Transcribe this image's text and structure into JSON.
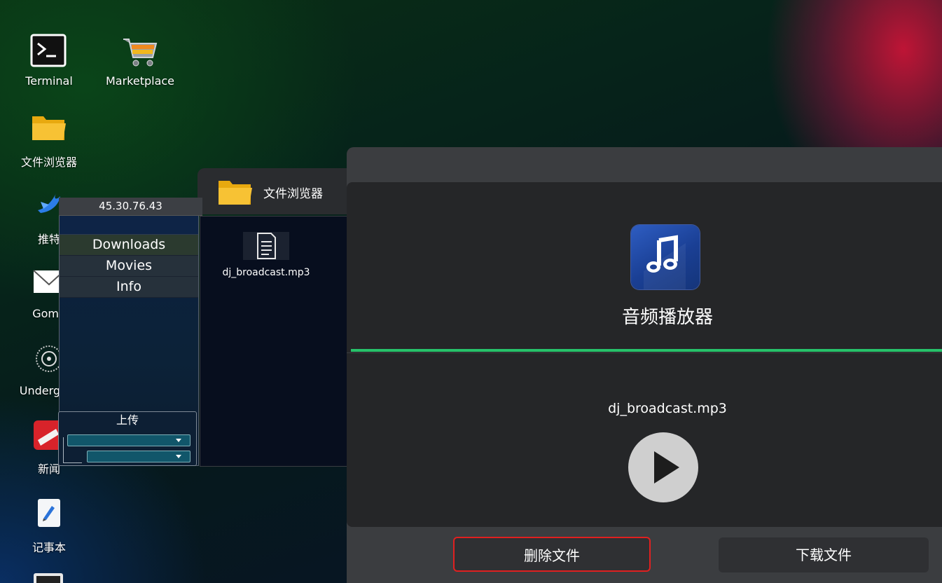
{
  "desktop": {
    "icons": [
      {
        "label": "Terminal",
        "icon": "terminal-icon"
      },
      {
        "label": "Marketplace",
        "icon": "shopping-cart-icon"
      },
      {
        "label": "文件浏览器",
        "icon": "folder-icon"
      },
      {
        "label": "推特",
        "icon": "bird-icon"
      },
      {
        "label": "Goma",
        "icon": "mail-icon"
      },
      {
        "label": "Undergrou",
        "icon": "underground-icon"
      },
      {
        "label": "新闻",
        "icon": "news-icon"
      },
      {
        "label": "记事本",
        "icon": "notepad-icon"
      }
    ]
  },
  "remote": {
    "ip": "45.30.76.43",
    "folders": [
      "Downloads",
      "Movies",
      "Info"
    ],
    "upload_label": "上传"
  },
  "file_browser": {
    "title": "文件浏览器",
    "files": [
      {
        "name": "dj_broadcast.mp3",
        "icon": "document-icon"
      }
    ]
  },
  "audio_player": {
    "app_name": "音频播放器",
    "track": "dj_broadcast.mp3",
    "delete_label": "删除文件",
    "download_label": "下载文件",
    "accent_color": "#27c16a",
    "highlight_color": "#e02020"
  }
}
